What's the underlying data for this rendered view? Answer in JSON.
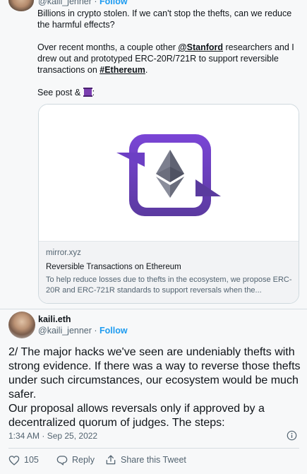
{
  "quoted": {
    "handle": "@kaili_jenner",
    "sep": " · ",
    "follow": "Follow",
    "p1": "Billions in crypto stolen. If we can't stop the thefts, can we reduce the harmful effects?",
    "p2_a": "Over recent months, a couple other ",
    "p2_mention": "@Stanford",
    "p2_b": " researchers and I drew out and prototyped ERC-20R/721R to support reversible transactions on ",
    "p2_hashtag": "#Ethereum",
    "p2_c": ".",
    "p3_a": "See post & ",
    "p3_b": ":",
    "thread_emoji": "thread-emoji"
  },
  "link_card": {
    "domain": "mirror.xyz",
    "title": "Reversible Transactions on Ethereum",
    "description": "To help reduce losses due to thefts in the ecosystem, we propose ERC-20R and ERC-721R standards to support reversals when the...",
    "image_icon": "ethereum-reversible-icon",
    "gradient_top": "#7a45d6",
    "gradient_bottom": "#5b3aa0"
  },
  "tweet": {
    "display_name": "kaili.eth",
    "handle": "@kaili_jenner",
    "sep": " · ",
    "follow": "Follow",
    "text_line1": "2/ The major hacks we've seen are undeniably thefts with strong evidence. If there was a way to reverse those thefts under such circumstances, our ecosystem would be much safer.",
    "text_line2": "Our proposal allows reversals only if approved by a decentralized quorum of judges. The steps:",
    "timestamp": "1:34 AM · Sep 25, 2022"
  },
  "actions": {
    "like_count": "105",
    "reply_label": "Reply",
    "share_label": "Share this Tweet"
  },
  "colors": {
    "accent": "#1d9bf0",
    "text_secondary": "#536471"
  }
}
